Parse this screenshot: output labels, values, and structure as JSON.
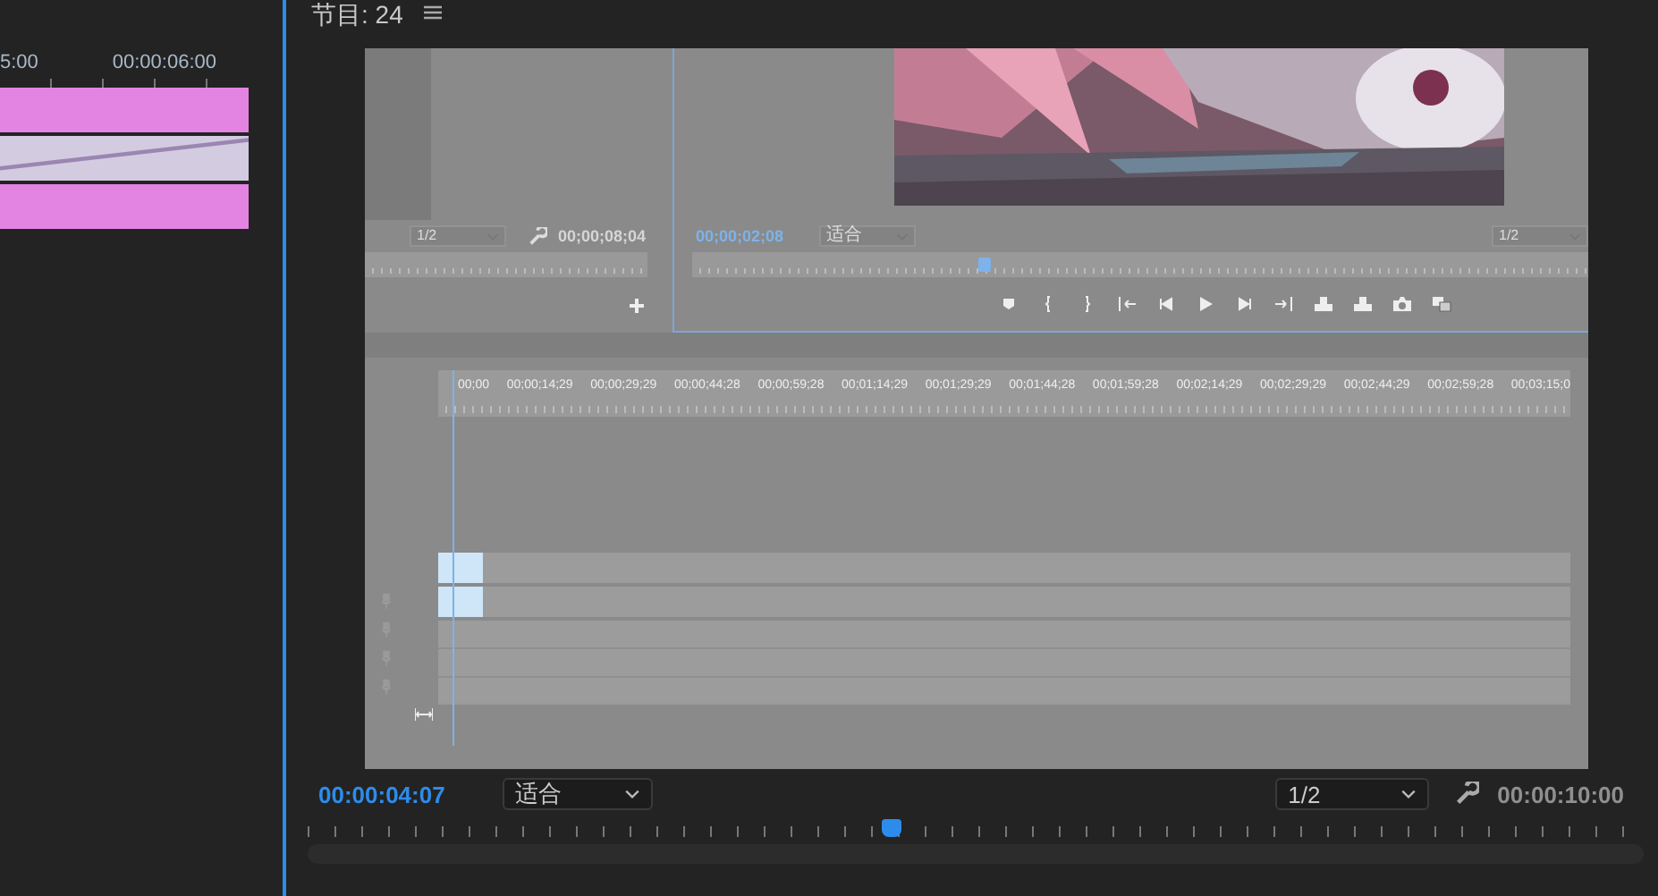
{
  "left_timeline": {
    "ruler_labels": [
      "5:00",
      "00:00:06:00"
    ],
    "tracks": [
      {
        "kind": "video"
      },
      {
        "kind": "audio"
      },
      {
        "kind": "video"
      }
    ]
  },
  "monitor": {
    "title": "节目: 24",
    "timecode": "00:00:04:07",
    "zoom_dropdown": "适合",
    "resolution_dropdown": "1/2",
    "duration": "00:00:10:00",
    "playhead": {
      "level": 0.43
    }
  },
  "embedded_screenshot": {
    "source_monitor": {
      "resolution": "1/2",
      "timecode": "00;00;08;04"
    },
    "program_monitor": {
      "timecode": "00;00;02;08",
      "zoom": "适合",
      "resolution": "1/2",
      "playhead": {
        "level": 0.32
      }
    },
    "timeline": {
      "ruler_labels": [
        "00;00",
        "00;00;14;29",
        "00;00;29;29",
        "00;00;44;28",
        "00;00;59;28",
        "00;01;14;29",
        "00;01;29;29",
        "00;01;44;28",
        "00;01;59;28",
        "00;02;14;29",
        "00;02;29;29",
        "00;02;44;29",
        "00;02;59;28",
        "00;03;15;0"
      ]
    }
  }
}
